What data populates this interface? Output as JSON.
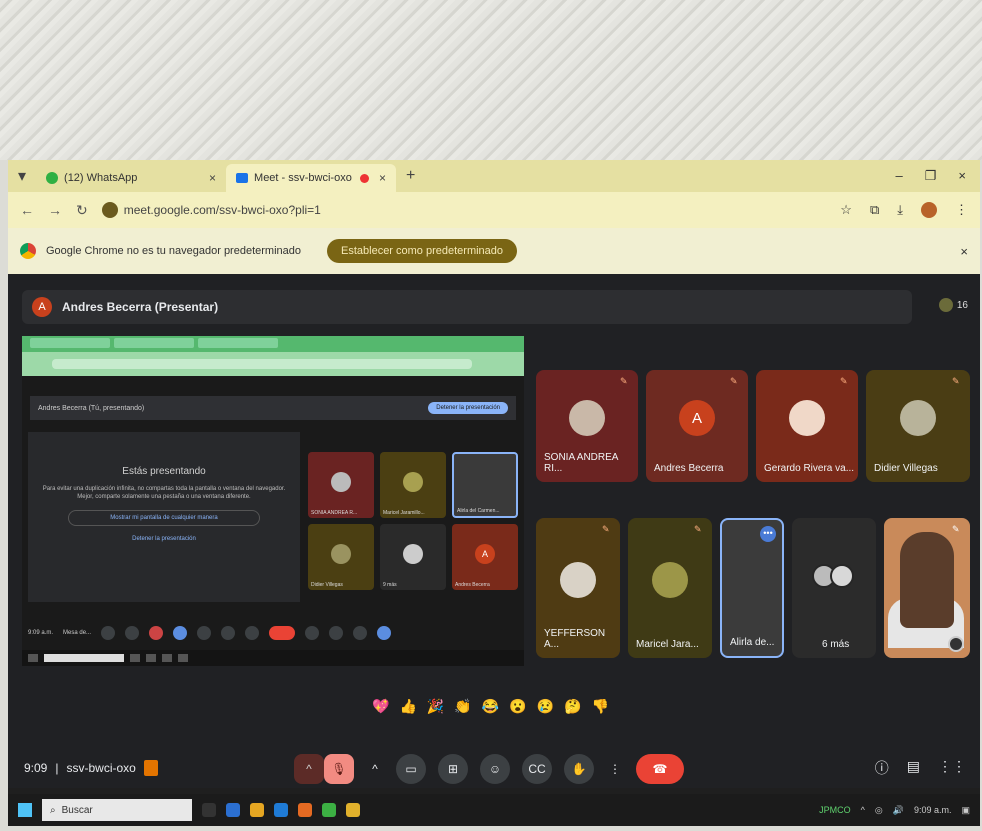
{
  "browser": {
    "tabs": [
      {
        "label": "(12) WhatsApp",
        "icon": "whatsapp-icon"
      },
      {
        "label": "Meet - ssv-bwci-oxo",
        "icon": "meet-icon"
      }
    ],
    "new_tab": "+",
    "address": "meet.google.com/ssv-bwci-oxo?pli=1",
    "infobar_text": "Google Chrome no es tu navegador predeterminado",
    "infobar_button": "Establecer como predeterminado",
    "close_symbol": "×"
  },
  "meet": {
    "presenter_label": "Andres Becerra (Presentar)",
    "presenter_initial": "A",
    "participant_count": "16",
    "shared_screen": {
      "inner_presenter": "Andres Becerra (Tú, presentando)",
      "stop_button": "Detener la presentación",
      "card_title": "Estás presentando",
      "card_desc": "Para evitar una duplicación infinita, no compartas toda la pantalla o ventana del navegador. Mejor, comparte solamente una pestaña o una ventana diferente.",
      "show_button": "Mostrar mi pantalla de cualquier manera",
      "stop_link": "Detener la presentación",
      "inner_time": "9:09 a.m.",
      "inner_meeting": "Mesa de...",
      "inner_search": "Buscar",
      "inner_tiles": [
        {
          "name": "SONIA ANDREA R...",
          "color": "#6a2322"
        },
        {
          "name": "Maricel Jaramillo...",
          "color": "#4b3f12"
        },
        {
          "name": "Alirla del Carmen...",
          "color": "#3a3a3a"
        },
        {
          "name": "Didier Villegas",
          "color": "#4b3f12"
        },
        {
          "name": "9 más",
          "color": "#2a2a2a"
        },
        {
          "name": "Andres Becerra",
          "color": "#7a2a1a"
        }
      ]
    },
    "tiles": [
      {
        "name": "SONIA ANDREA RI...",
        "color": "#6a2322"
      },
      {
        "name": "Andres Becerra",
        "color": "#6e2a21",
        "initial": "A"
      },
      {
        "name": "Gerardo Rivera va...",
        "color": "#7a2a1a"
      },
      {
        "name": "Didier Villegas",
        "color": "#4a3d14"
      },
      {
        "name": "YEFFERSON A...",
        "color": "#4f3b13"
      },
      {
        "name": "Maricel Jara...",
        "color": "#3f3a15"
      },
      {
        "name": "Alirla de...",
        "color": "#3b3b3b"
      },
      {
        "name": "6 más",
        "color": "#2b2b2b"
      }
    ],
    "more_symbol": "•••",
    "reactions": [
      "💖",
      "👍",
      "🎉",
      "👏",
      "😂",
      "😮",
      "😢",
      "🤔",
      "👎"
    ],
    "meeting_time": "9:09",
    "meeting_code": "ssv-bwci-oxo"
  },
  "taskbar": {
    "search_placeholder": "Buscar",
    "tray_label": "JPMCO",
    "tray_time": "9:09 a.m."
  }
}
